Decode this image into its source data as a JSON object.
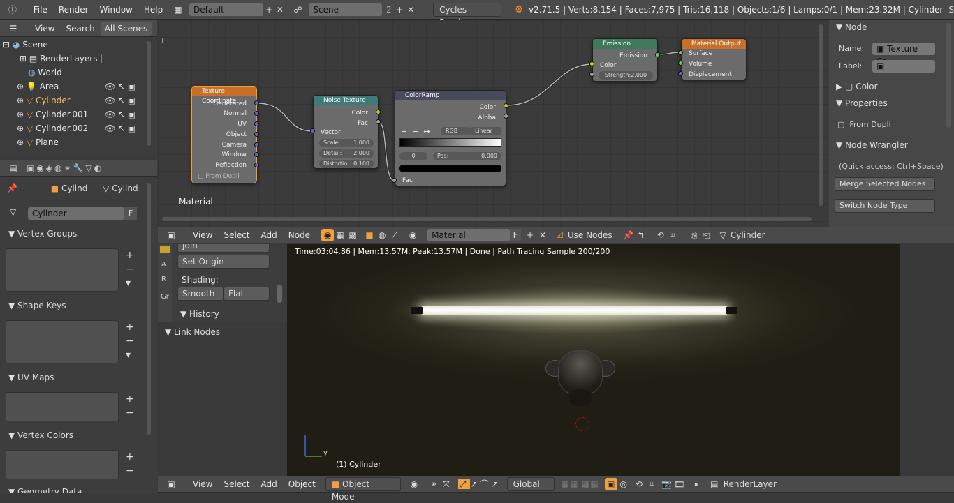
{
  "topbar": {
    "menus": [
      "File",
      "Render",
      "Window",
      "Help"
    ],
    "layout_name": "Default",
    "scene_name": "Scene",
    "scene_users": "2",
    "engine": "Cycles Render",
    "stats": "v2.71.5 | Verts:8,154 | Faces:7,975 | Tris:16,118 | Objects:1/6 | Lamps:0/1 | Mem:23.32M | Cylinder",
    "overflow": "S"
  },
  "outliner": {
    "view": "View",
    "search": "Search",
    "scope": "All Scenes",
    "items": [
      {
        "label": "Scene"
      },
      {
        "label": "RenderLayers"
      },
      {
        "label": "World"
      },
      {
        "label": "Area"
      },
      {
        "label": "Cylinder"
      },
      {
        "label": "Cylinder.001"
      },
      {
        "label": "Cylinder.002"
      },
      {
        "label": "Plane"
      }
    ]
  },
  "properties": {
    "crumb1": "Cylind",
    "crumb2": "Cylind",
    "object_name": "Cylinder",
    "fake_user": "F",
    "vertex_groups": "Vertex Groups",
    "shape_keys": "Shape Keys",
    "uv_maps": "UV Maps",
    "vertex_colors": "Vertex Colors",
    "geometry_data": "Geometry Data"
  },
  "node_editor": {
    "label": "Material",
    "nodes": {
      "texcoord": {
        "title": "Texture Coordinate",
        "outputs": [
          "Generated",
          "Normal",
          "UV",
          "Object",
          "Camera",
          "Window",
          "Reflection"
        ],
        "from_dupli": "From Dupli"
      },
      "noise": {
        "title": "Noise Texture",
        "outputs": [
          "Color",
          "Fac"
        ],
        "input": "Vector",
        "scale_label": "Scale:",
        "scale": "1.000",
        "detail_label": "Detail:",
        "detail": "2.000",
        "distortion_label": "Distortio:",
        "distortion": "0.100"
      },
      "ramp": {
        "title": "ColorRamp",
        "outputs": [
          "Color",
          "Alpha"
        ],
        "mode": "RGB",
        "interp": "Linear",
        "index": "0",
        "pos_label": "Pos:",
        "pos": "0.000",
        "input": "Fac"
      },
      "emission": {
        "title": "Emission",
        "output": "Emission",
        "color": "Color",
        "strength": "Strength:2.000"
      },
      "output": {
        "title": "Material Output",
        "inputs": [
          "Surface",
          "Volume",
          "Displacement"
        ]
      }
    }
  },
  "node_sidebar": {
    "node_header": "Node",
    "name_label": "Name:",
    "name_value": "Texture Co...",
    "label_label": "Label:",
    "color_header": "Color",
    "properties_header": "Properties",
    "from_dupli": "From Dupli",
    "wrangler_header": "Node Wrangler",
    "quick_access": "(Quick access: Ctrl+Space)",
    "merge": "Merge Selected Nodes",
    "switch": "Switch Node Type"
  },
  "node_header": {
    "menus": [
      "View",
      "Select",
      "Add",
      "Node"
    ],
    "material": "Material",
    "fake_user": "F",
    "use_nodes": "Use Nodes",
    "object": "Cylinder"
  },
  "tool_shelf": {
    "join": "Join",
    "set_origin": "Set Origin",
    "shading": "Shading:",
    "smooth": "Smooth",
    "flat": "Flat",
    "history": "History",
    "link_nodes": "Link Nodes",
    "tabs": [
      "A",
      "R",
      "Gr"
    ]
  },
  "viewport": {
    "render_info": "Time:03:04.86 | Mem:13.57M, Peak:13.57M | Done | Path Tracing Sample 200/200",
    "object_label": "(1) Cylinder"
  },
  "view3d_header": {
    "menus": [
      "View",
      "Select",
      "Add",
      "Object"
    ],
    "mode": "Object Mode",
    "orientation": "Global",
    "render_layer": "RenderLayer"
  }
}
